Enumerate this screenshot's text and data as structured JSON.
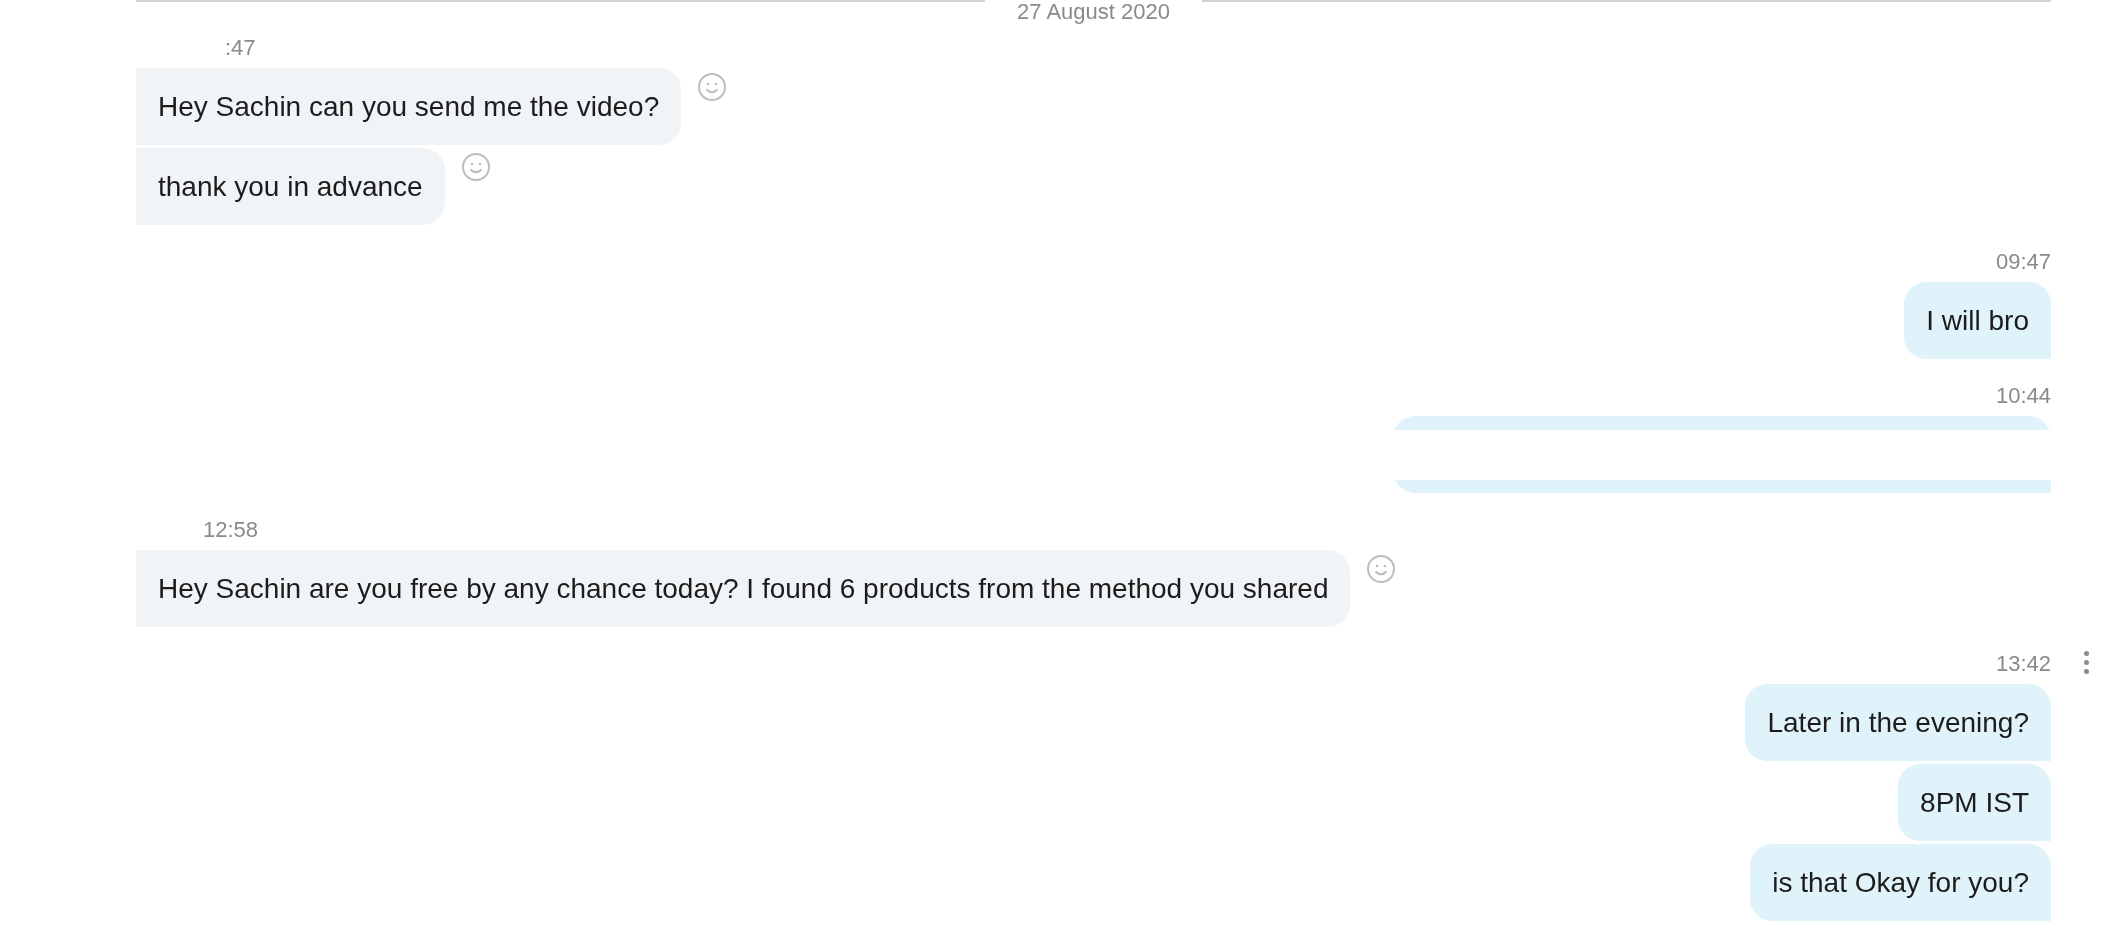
{
  "date_separator": "27 August 2020",
  "messages": [
    {
      "kind": "received",
      "time": ":47",
      "bubbles": [
        {
          "text": "Hey Sachin can you send me the video?"
        },
        {
          "text": "thank you in advance"
        }
      ]
    },
    {
      "kind": "sent",
      "time": "09:47",
      "bubbles": [
        {
          "text": "I will bro"
        }
      ]
    },
    {
      "kind": "sent",
      "time": "10:44",
      "bubbles": [
        {
          "kind": "redacted"
        }
      ]
    },
    {
      "kind": "received",
      "time": "12:58",
      "bubbles": [
        {
          "text": "Hey Sachin are you free by any chance today? I found 6 products from the method you shared"
        }
      ]
    },
    {
      "kind": "sent",
      "time": "13:42",
      "bubbles": [
        {
          "text": "Later in the evening?"
        },
        {
          "text": "8PM IST"
        },
        {
          "text": "is that Okay for you?"
        }
      ]
    }
  ]
}
